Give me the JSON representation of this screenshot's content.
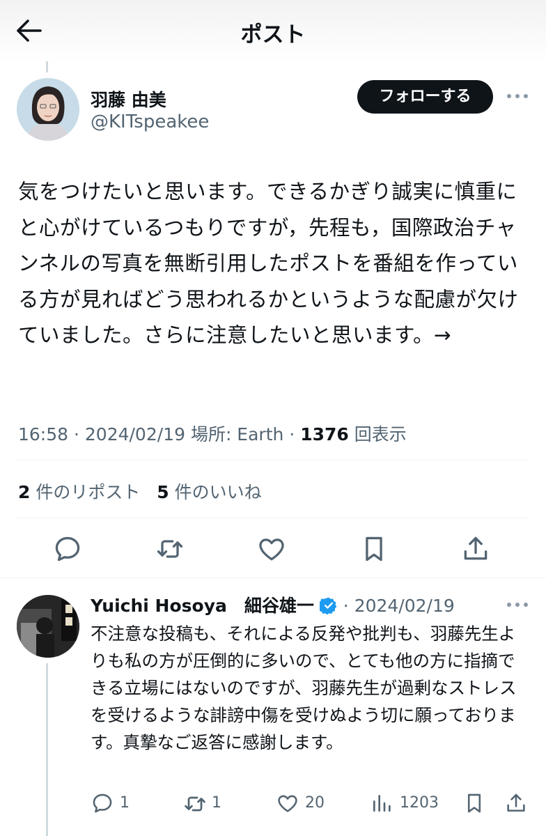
{
  "header": {
    "title": "ポスト",
    "back_icon": "arrow-left-icon"
  },
  "post": {
    "author_name": "羽藤 由美",
    "author_handle": "@KITspeakee",
    "follow_label": "フォローする",
    "text": "気をつけたいと思います。できるかぎり誠実に慎重にと心がけているつもりですが，先程も，国際政治チャンネルの写真を無断引用したポストを番組を作っている方が見ればどう思われるかというような配慮が欠けていました。さらに注意したいと思います。→",
    "time": "16:58",
    "date": "2024/02/19",
    "location": "場所: Earth",
    "views_count": "1376",
    "views_label": "回表示",
    "reposts_count": "2",
    "reposts_label": "件のリポスト",
    "likes_count": "5",
    "likes_label": "件のいいね"
  },
  "reply": {
    "author_name": "Yuichi Hosoya　細谷雄一",
    "date": "2024/02/19",
    "text": "不注意な投稿も、それによる反発や批判も、羽藤先生よりも私の方が圧倒的に多いので、とても他の方に指摘できる立場にはないのですが、羽藤先生が過剰なストレスを受けるような誹謗中傷を受けぬよう切に願っております。真摯なご返答に感謝します。",
    "replies": "1",
    "reposts": "1",
    "likes": "20",
    "views": "1203"
  },
  "colors": {
    "text": "#0f1419",
    "secondary": "#536471",
    "verified": "#1d9bf0",
    "divider": "#eff3f4"
  }
}
